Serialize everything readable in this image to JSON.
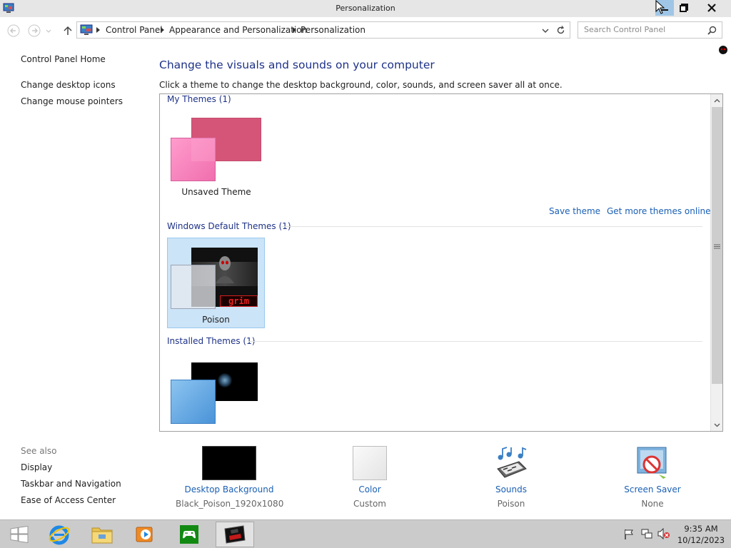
{
  "window": {
    "title": "Personalization"
  },
  "address": {
    "crumbs": [
      "Control Panel",
      "Appearance and Personalization",
      "Personalization"
    ],
    "search_placeholder": "Search Control Panel"
  },
  "left_nav": {
    "home": "Control Panel Home",
    "items": [
      "Change desktop icons",
      "Change mouse pointers"
    ]
  },
  "see_also": {
    "label": "See also",
    "items": [
      "Display",
      "Taskbar and Navigation",
      "Ease of Access Center"
    ]
  },
  "main": {
    "heading": "Change the visuals and sounds on your computer",
    "subheading": "Click a theme to change the desktop background, color, sounds, and screen saver all at once."
  },
  "groups": {
    "my_themes": {
      "label": "My Themes (1)",
      "theme_name": "Unsaved Theme"
    },
    "default_themes": {
      "label": "Windows Default Themes (1)",
      "theme_name": "Poison",
      "thumb_text": "grim"
    },
    "installed_themes": {
      "label": "Installed Themes (1)"
    }
  },
  "links": {
    "save_theme": "Save theme",
    "get_more": "Get more themes online"
  },
  "bottom": [
    {
      "label": "Desktop Background",
      "value": "Black_Poison_1920x1080"
    },
    {
      "label": "Color",
      "value": "Custom"
    },
    {
      "label": "Sounds",
      "value": "Poison"
    },
    {
      "label": "Screen Saver",
      "value": "None"
    }
  ],
  "taskbar": {
    "items": [
      "start-icon",
      "internet-explorer-icon",
      "file-explorer-icon",
      "media-player-icon",
      "games-icon",
      "personalization-icon"
    ],
    "time": "9:35 AM",
    "date": "10/12/2023"
  },
  "colors": {
    "heading": "#1e3287",
    "link": "#1a5fb4",
    "selected_bg": "#cce4f7",
    "selected_border": "#99c9ef",
    "unsaved_pink": "#d55579"
  }
}
